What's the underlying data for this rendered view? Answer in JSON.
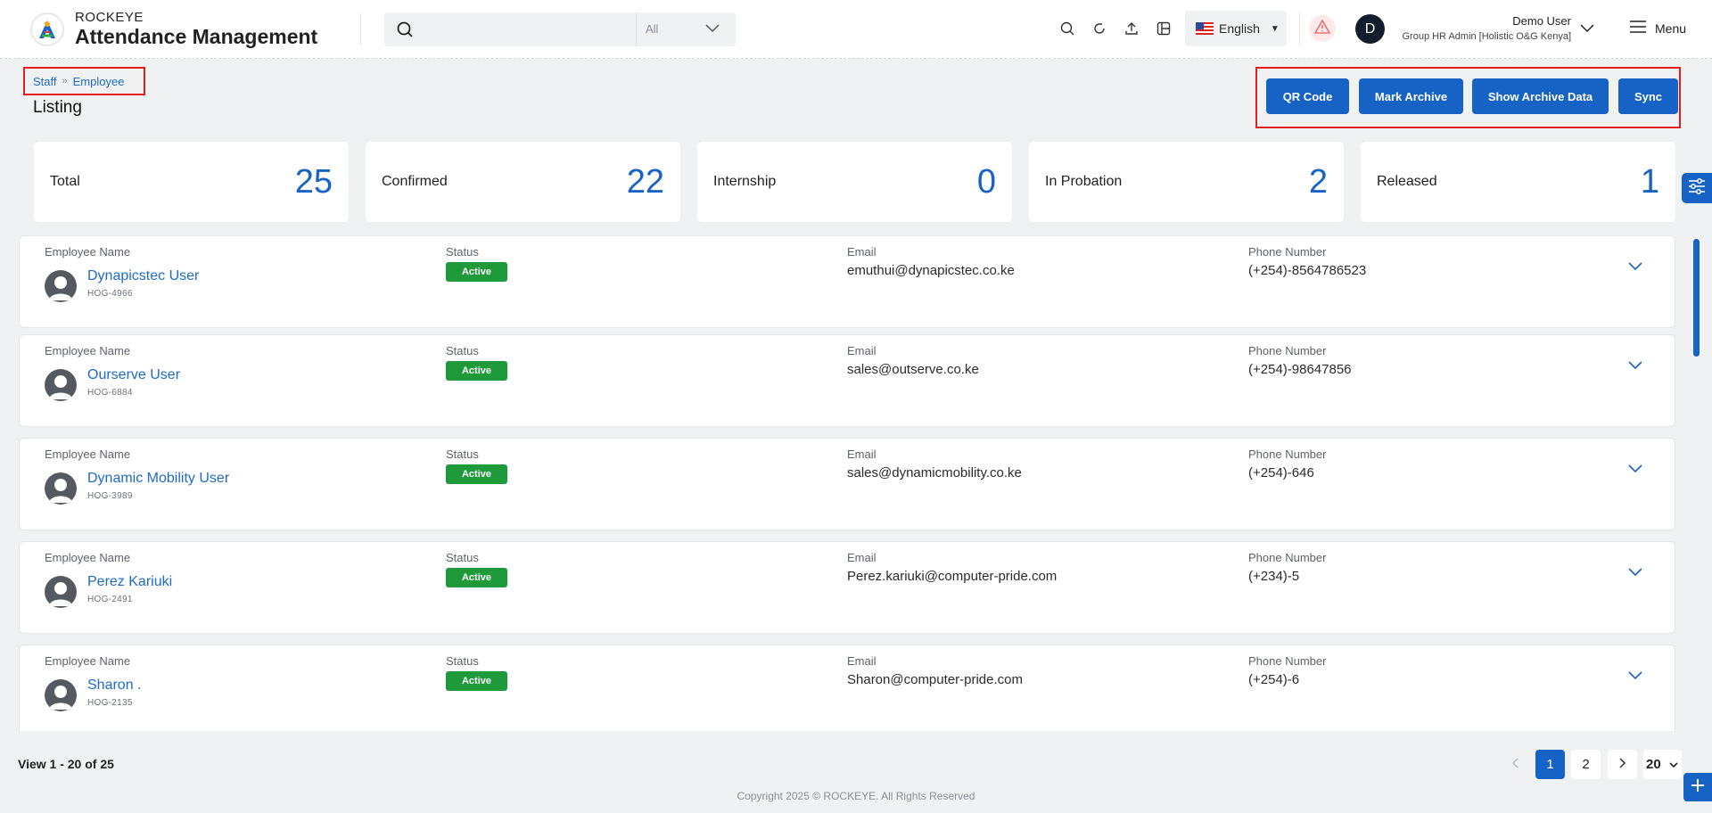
{
  "header": {
    "brand": "ROCKEYE",
    "app_title": "Attendance Management",
    "search": {
      "placeholder": "",
      "scope": "All"
    },
    "language": "English",
    "user": {
      "initial": "D",
      "name": "Demo User",
      "role": "Group HR Admin [Holistic O&G Kenya]"
    },
    "menu_label": "Menu"
  },
  "breadcrumb": {
    "items": [
      "Staff",
      "Employee"
    ]
  },
  "page_title": "Listing",
  "actions": {
    "qr_code": "QR Code",
    "mark_archive": "Mark Archive",
    "show_archive": "Show Archive Data",
    "sync": "Sync"
  },
  "stats": [
    {
      "label": "Total",
      "value": "25"
    },
    {
      "label": "Confirmed",
      "value": "22"
    },
    {
      "label": "Internship",
      "value": "0"
    },
    {
      "label": "In Probation",
      "value": "2"
    },
    {
      "label": "Released",
      "value": "1"
    }
  ],
  "columns": {
    "name": "Employee Name",
    "status": "Status",
    "email": "Email",
    "phone": "Phone Number"
  },
  "employees": [
    {
      "name": "Dynapicstec User",
      "code": "HOG-4966",
      "status": "Active",
      "email": "emuthui@dynapicstec.co.ke",
      "phone": "(+254)-8564786523"
    },
    {
      "name": "Ourserve User",
      "code": "HOG-6884",
      "status": "Active",
      "email": "sales@outserve.co.ke",
      "phone": "(+254)-98647856"
    },
    {
      "name": "Dynamic Mobility User",
      "code": "HOG-3989",
      "status": "Active",
      "email": "sales@dynamicmobility.co.ke",
      "phone": "(+254)-646"
    },
    {
      "name": "Perez Kariuki",
      "code": "HOG-2491",
      "status": "Active",
      "email": "Perez.kariuki@computer-pride.com",
      "phone": "(+234)-5"
    },
    {
      "name": "Sharon .",
      "code": "HOG-2135",
      "status": "Active",
      "email": "Sharon@computer-pride.com",
      "phone": "(+254)-6"
    }
  ],
  "footer": {
    "view_text": "View 1 - 20 of 25",
    "pages": [
      "1",
      "2"
    ],
    "current_page": "1",
    "page_size": "20",
    "copyright": "Copyright 2025 © ROCKEYE. All Rights Reserved"
  },
  "colors": {
    "primary": "#1763c5",
    "active_badge": "#1f9a3a",
    "highlight_frame": "#e41d1d"
  }
}
